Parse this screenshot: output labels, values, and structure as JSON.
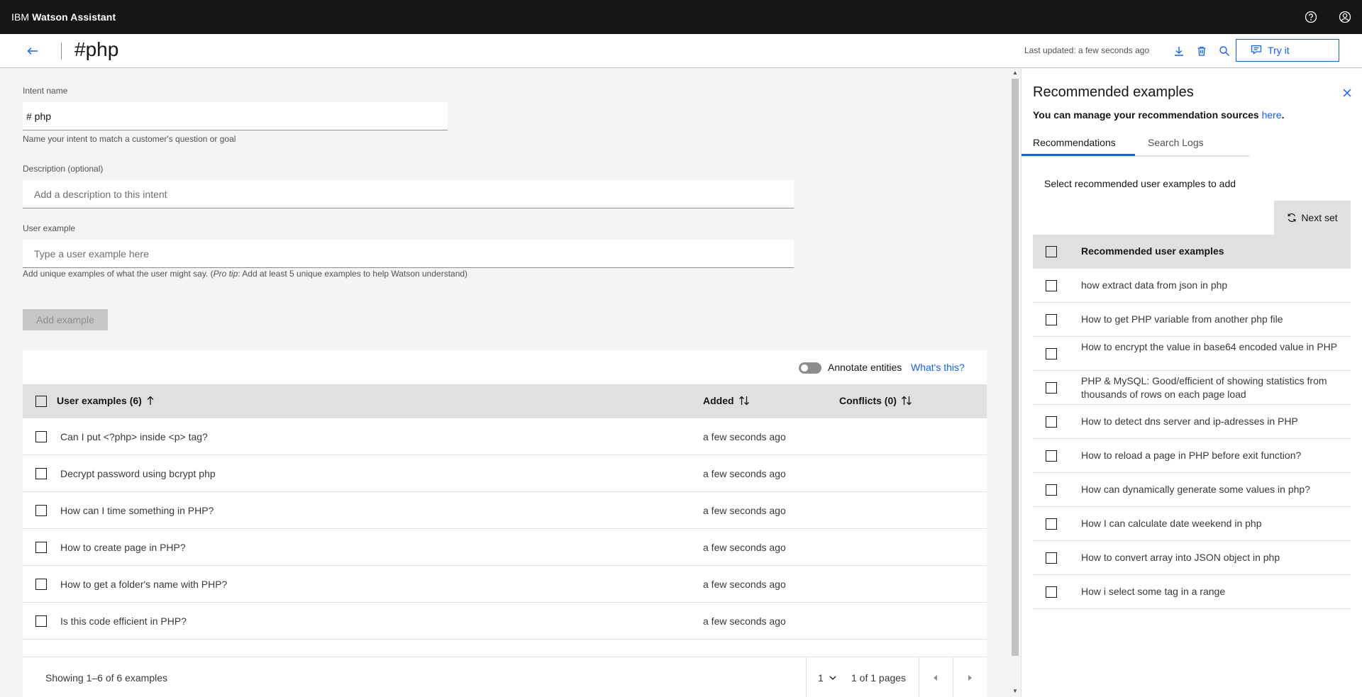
{
  "app": {
    "brand_prefix": "IBM",
    "brand_name": "Watson Assistant"
  },
  "header": {
    "title": "#php",
    "last_updated": "Last updated: a few seconds ago",
    "try_it": "Try it"
  },
  "form": {
    "intent_label": "Intent name",
    "intent_value": "# php",
    "intent_helper": "Name your intent to match a customer's question or goal",
    "description_label": "Description (optional)",
    "description_placeholder": "Add a description to this intent",
    "example_label": "User example",
    "example_placeholder": "Type a user example here",
    "example_helper_prefix": "Add unique examples of what the user might say. (",
    "example_helper_tip": "Pro tip",
    "example_helper_suffix": ": Add at least 5 unique examples to help Watson understand)",
    "add_button": "Add example"
  },
  "table": {
    "annotate_label": "Annotate entities",
    "whats_this": "What's this?",
    "col_examples": "User examples (6)",
    "col_added": "Added",
    "col_conflicts": "Conflicts (0)",
    "rows": [
      {
        "text": "Can I put <?php> inside <p> tag?",
        "added": "a few seconds ago"
      },
      {
        "text": "Decrypt password using bcrypt php",
        "added": "a few seconds ago"
      },
      {
        "text": "How can I time something in PHP?",
        "added": "a few seconds ago"
      },
      {
        "text": "How to create page in PHP?",
        "added": "a few seconds ago"
      },
      {
        "text": "How to get a folder's name with PHP?",
        "added": "a few seconds ago"
      },
      {
        "text": "Is this code efficient in PHP?",
        "added": "a few seconds ago"
      }
    ],
    "showing": "Showing 1–6 of 6 examples",
    "page": "1",
    "page_of": "1 of 1 pages"
  },
  "panel": {
    "title": "Recommended examples",
    "subtitle": "You can manage your recommendation sources",
    "subtitle_link": "here",
    "subtitle_end": ".",
    "tab_recommendations": "Recommendations",
    "tab_search_logs": "Search Logs",
    "select_text": "Select recommended user examples to add",
    "next_set": "Next set",
    "col_header": "Recommended user examples",
    "items": [
      "how extract data from json in php",
      "How to get PHP variable from another php file",
      "How to encrypt the value in base64 encoded value in PHP",
      "PHP & MySQL: Good/efficient of showing statistics from thousands of rows on each page load",
      "How to detect dns server and ip-adresses in PHP",
      "How to reload a page in PHP before exit function?",
      "How can dynamically generate some values in php?",
      "How I can calculate date weekend in php",
      "How to convert array into JSON object in php",
      "How i select some tag in a range"
    ]
  },
  "colors": {
    "accent": "#0f62fe",
    "topbar": "#161616"
  }
}
